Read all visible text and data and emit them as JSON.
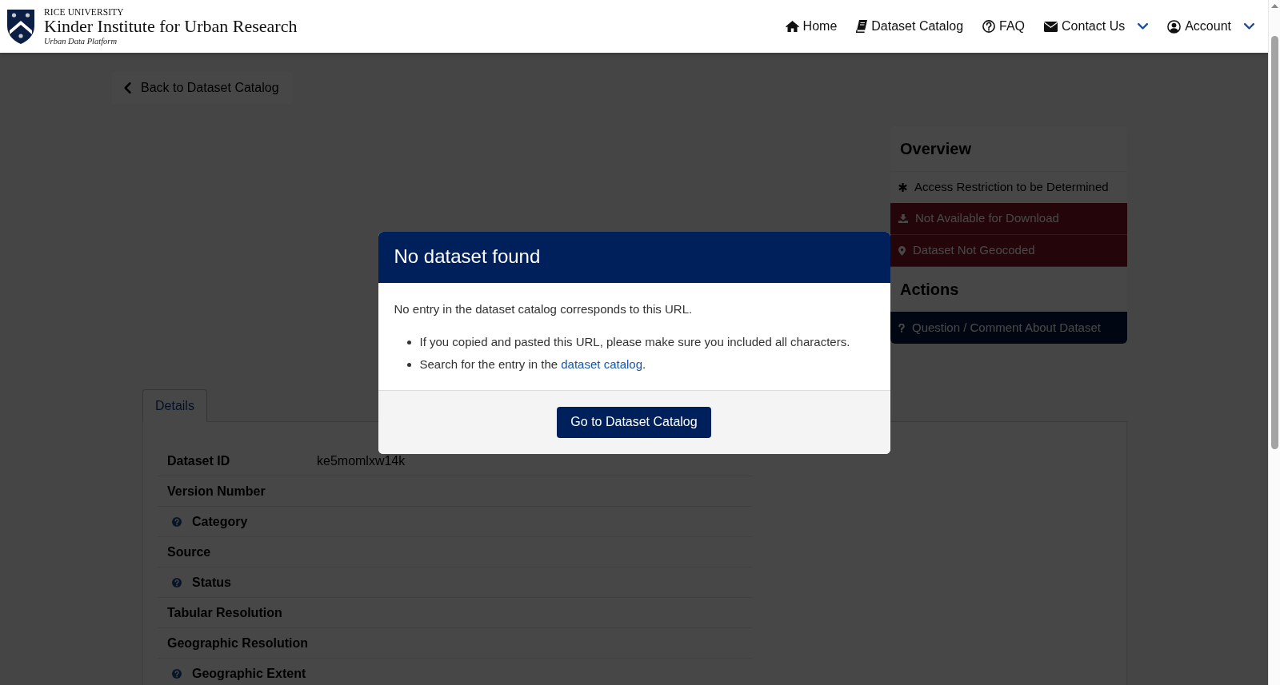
{
  "header": {
    "logo": {
      "overline": "RICE UNIVERSITY",
      "title": "Kinder Institute for Urban Research",
      "tagline": "Urban Data Platform"
    },
    "nav": [
      {
        "label": "Home",
        "dropdown": false
      },
      {
        "label": "Dataset Catalog",
        "dropdown": false
      },
      {
        "label": "FAQ",
        "dropdown": false
      },
      {
        "label": "Contact Us",
        "dropdown": true
      },
      {
        "label": "Account",
        "dropdown": true
      }
    ]
  },
  "back_link": {
    "label": "Back to Dataset Catalog"
  },
  "sidebar": {
    "sections": [
      {
        "title": "Overview",
        "items": [
          {
            "label": "Access Restriction to be Determined",
            "kind": "info"
          },
          {
            "label": "Not Available for Download",
            "kind": "alert"
          },
          {
            "label": "Dataset Not Geocoded",
            "kind": "alert"
          }
        ]
      },
      {
        "title": "Actions",
        "items": [
          {
            "label": "Question / Comment About Dataset",
            "kind": "action"
          }
        ]
      }
    ]
  },
  "tabs": [
    {
      "label": "Details",
      "selected": true
    }
  ],
  "details": {
    "rows": [
      {
        "label": "Dataset ID",
        "value": "ke5momlxw14k",
        "help": false
      },
      {
        "label": "Version Number",
        "help": false
      },
      {
        "label": "Category",
        "help": true
      },
      {
        "label": "Source",
        "help": false
      },
      {
        "label": "Status",
        "help": true
      },
      {
        "label": "Tabular Resolution",
        "help": false
      },
      {
        "label": "Geographic Resolution",
        "help": false
      },
      {
        "label": "Geographic Extent",
        "help": true
      }
    ]
  },
  "modal": {
    "title": "No dataset found",
    "message": "No entry in the dataset catalog corresponds to this URL.",
    "bullets": [
      {
        "parts": [
          {
            "kind": "text",
            "text": "If you copied and pasted this URL, please make sure you included all characters."
          }
        ]
      },
      {
        "parts": [
          {
            "kind": "text",
            "text": "Search for the entry in the "
          },
          {
            "kind": "link",
            "text": "dataset catalog"
          },
          {
            "kind": "text",
            "text": "."
          }
        ]
      }
    ],
    "button": "Go to Dataset Catalog"
  }
}
